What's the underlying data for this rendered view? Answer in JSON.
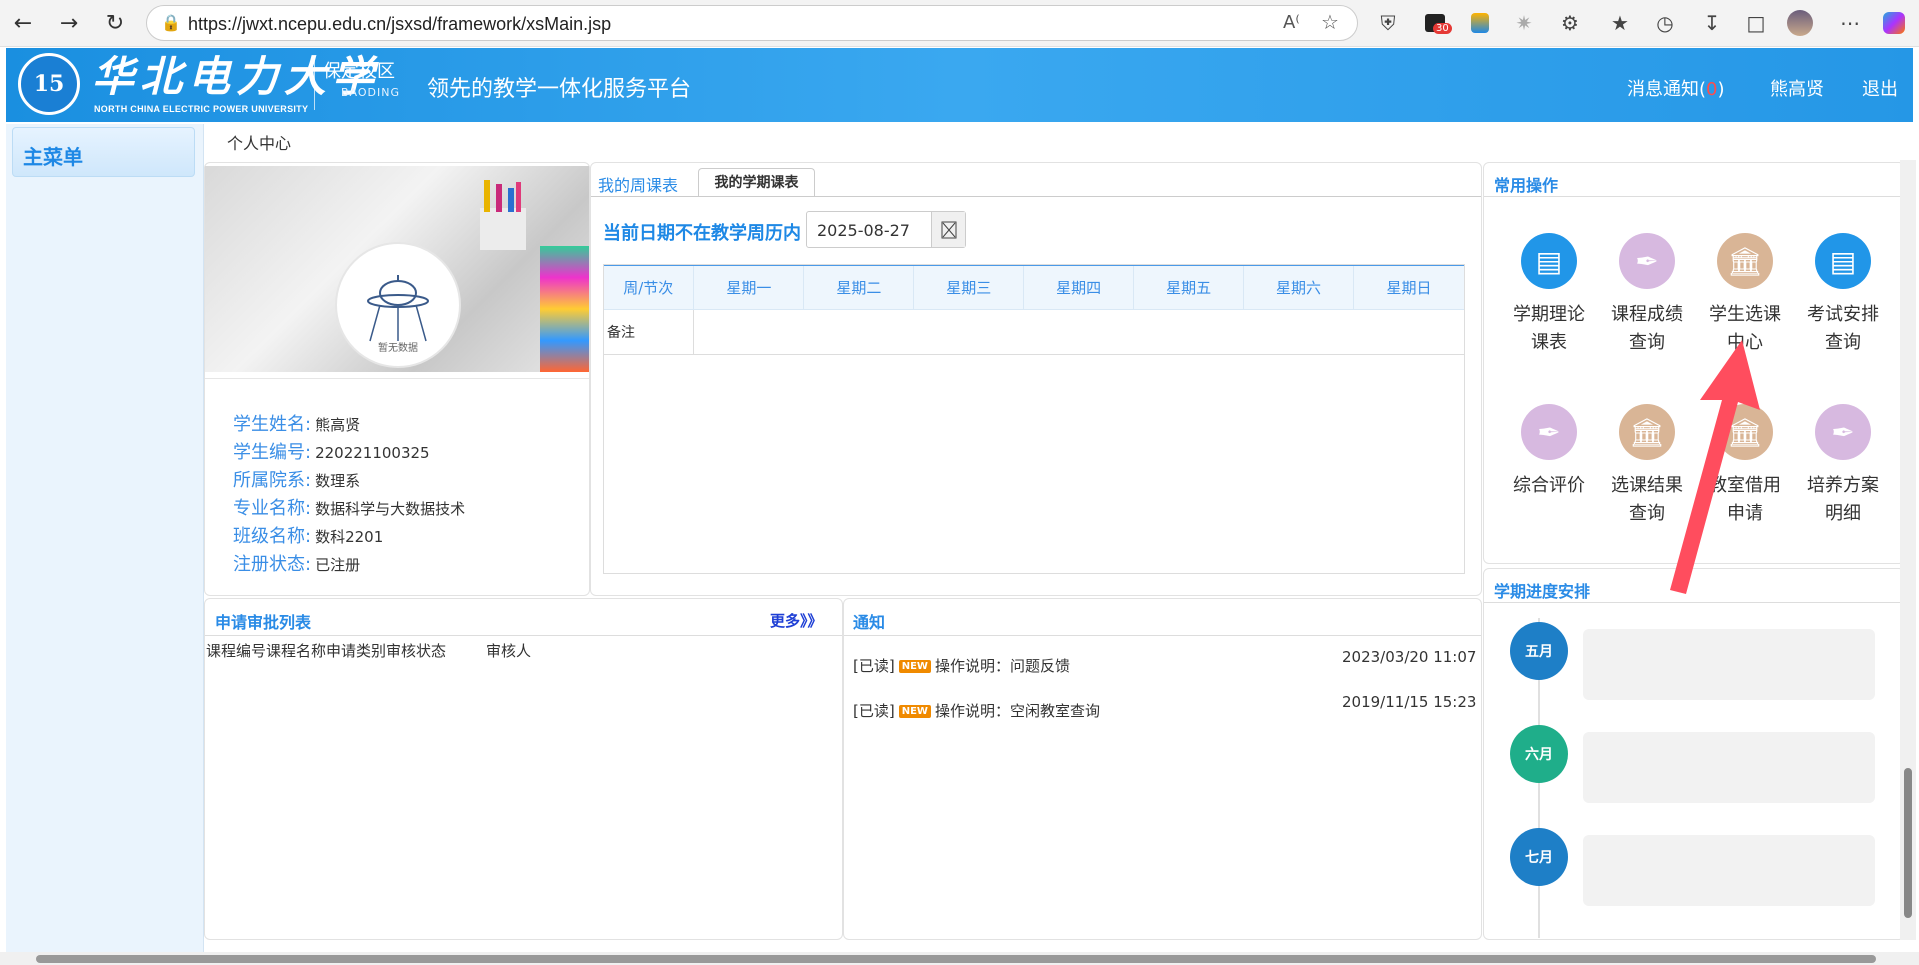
{
  "browser": {
    "url": "https://jwxt.ncepu.edu.cn/jsxsd/framework/xsMain.jsp",
    "badge_count": "30"
  },
  "header": {
    "logo_text": "15",
    "brand_cn": "华北电力大学",
    "brand_en": "NORTH CHINA ELECTRIC POWER UNIVERSITY",
    "campus_cn": "保定校区",
    "campus_en": "BAODING",
    "slogan": "领先的教学一体化服务平台",
    "messages_label": "消息通知(",
    "messages_count": "0",
    "messages_close": ")",
    "user_name": "熊高贤",
    "logout": "退出"
  },
  "sidebar": {
    "main_menu": "主菜单"
  },
  "breadcrumb": "个人中心",
  "profile": {
    "no_data": "暂无数据",
    "rows": [
      {
        "label": "学生姓名:",
        "value": "熊高贤"
      },
      {
        "label": "学生编号:",
        "value": "220221100325"
      },
      {
        "label": "所属院系:",
        "value": "数理系"
      },
      {
        "label": "专业名称:",
        "value": "数据科学与大数据技术"
      },
      {
        "label": "班级名称:",
        "value": "数科2201"
      },
      {
        "label": "注册状态:",
        "value": "已注册"
      }
    ]
  },
  "schedule": {
    "tab_week": "我的周课表",
    "tab_term": "我的学期课表",
    "notice": "当前日期不在教学周历内",
    "date_value": "2025-08-27",
    "headers": [
      "周/节次",
      "星期一",
      "星期二",
      "星期三",
      "星期四",
      "星期五",
      "星期六",
      "星期日"
    ],
    "remark_label": "备注"
  },
  "quick_ops": {
    "title": "常用操作",
    "items": [
      {
        "line1": "学期理论",
        "line2": "课表",
        "icon": "message-icon",
        "color": "#2196e8"
      },
      {
        "line1": "课程成绩",
        "line2": "查询",
        "icon": "quill-icon",
        "color": "#d7b9e0"
      },
      {
        "line1": "学生选课",
        "line2": "中心",
        "icon": "bank-icon",
        "color": "#d9b596"
      },
      {
        "line1": "考试安排",
        "line2": "查询",
        "icon": "message-icon",
        "color": "#2196e8"
      },
      {
        "line1": "综合评价",
        "line2": "",
        "icon": "quill-icon",
        "color": "#d7b9e0"
      },
      {
        "line1": "选课结果",
        "line2": "查询",
        "icon": "bank-icon",
        "color": "#d9b596"
      },
      {
        "line1": "教室借用",
        "line2": "申请",
        "icon": "bank-icon",
        "color": "#d9b596"
      },
      {
        "line1": "培养方案",
        "line2": "明细",
        "icon": "quill-icon",
        "color": "#d7b9e0"
      }
    ]
  },
  "approval": {
    "title": "申请审批列表",
    "more": "更多》》",
    "columns": [
      "课程编号",
      "课程名称",
      "申请类别",
      "审核状态",
      "审核人"
    ]
  },
  "notices": {
    "title": "通知",
    "items": [
      {
        "status": "[已读]",
        "badge": "NEW",
        "text": "操作说明：问题反馈",
        "date": "2023/03/20 11:07"
      },
      {
        "status": "[已读]",
        "badge": "NEW",
        "text": "操作说明：空闲教室查询",
        "date": "2019/11/15 15:23"
      }
    ]
  },
  "term_progress": {
    "title": "学期进度安排",
    "months": [
      {
        "label": "五月",
        "color": "#1e7fc7"
      },
      {
        "label": "六月",
        "color": "#1fae8a"
      },
      {
        "label": "七月",
        "color": "#1e7fc7"
      }
    ]
  }
}
